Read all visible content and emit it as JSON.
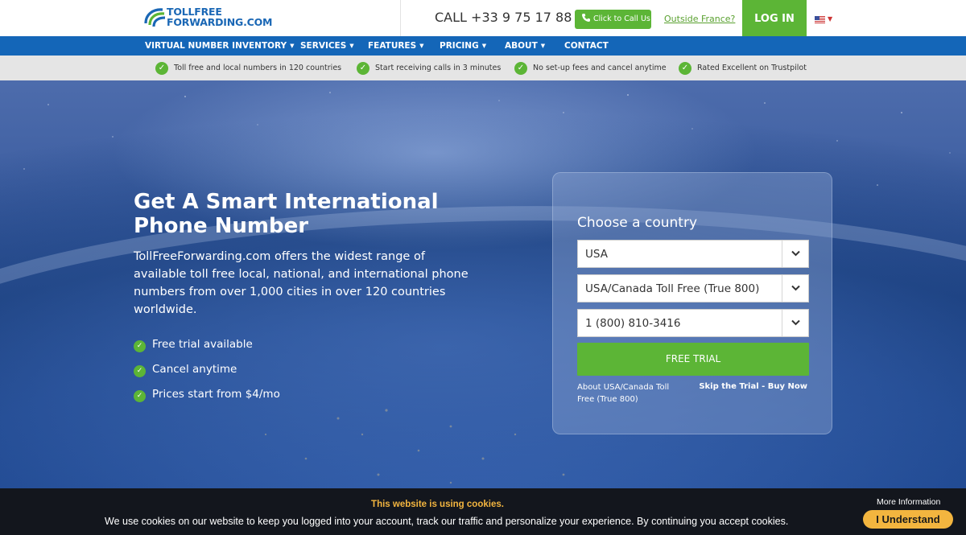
{
  "header": {
    "logo_line1": "TOLLFREE",
    "logo_line2": "FORWARDING.COM",
    "call_text": "CALL +33 9 75 17 88 40",
    "click_call_label": "Click to Call Us",
    "outside_label": "Outside France?",
    "login_label": "LOG IN",
    "flag_icon": "us-flag-icon"
  },
  "nav": {
    "items": [
      {
        "label": "VIRTUAL NUMBER INVENTORY",
        "dropdown": true
      },
      {
        "label": "SERVICES",
        "dropdown": true
      },
      {
        "label": "FEATURES",
        "dropdown": true
      },
      {
        "label": "PRICING",
        "dropdown": true
      },
      {
        "label": "ABOUT",
        "dropdown": true
      },
      {
        "label": "CONTACT",
        "dropdown": false
      }
    ]
  },
  "features": [
    "Toll free and local numbers in 120 countries",
    "Start receiving calls in 3 minutes",
    "No set-up fees and cancel anytime",
    "Rated Excellent on Trustpilot"
  ],
  "hero": {
    "title": "Get A Smart International Phone Number",
    "description": "TollFreeForwarding.com offers the widest range of available toll free local, national, and international phone numbers from over 1,000 cities in over 120 countries worldwide.",
    "bullets": [
      "Free trial available",
      "Cancel anytime",
      "Prices start from $4/mo"
    ]
  },
  "form": {
    "title": "Choose a country",
    "country": "USA",
    "number_type": "USA/Canada Toll Free (True 800)",
    "number": "1 (800) 810-3416",
    "trial_button": "FREE TRIAL",
    "about_link": "About USA/Canada Toll Free (True 800)",
    "skip_link": "Skip the Trial - Buy Now"
  },
  "cookie": {
    "title": "This website is using cookies.",
    "text": "We use cookies on our website to keep you logged into your account, track our traffic and personalize your experience. By continuing you accept cookies.",
    "more_info": "More Information",
    "accept_button": "I Understand"
  },
  "colors": {
    "brand_blue": "#1466b8",
    "brand_green": "#5cb536",
    "cookie_accent": "#f3b53f"
  }
}
